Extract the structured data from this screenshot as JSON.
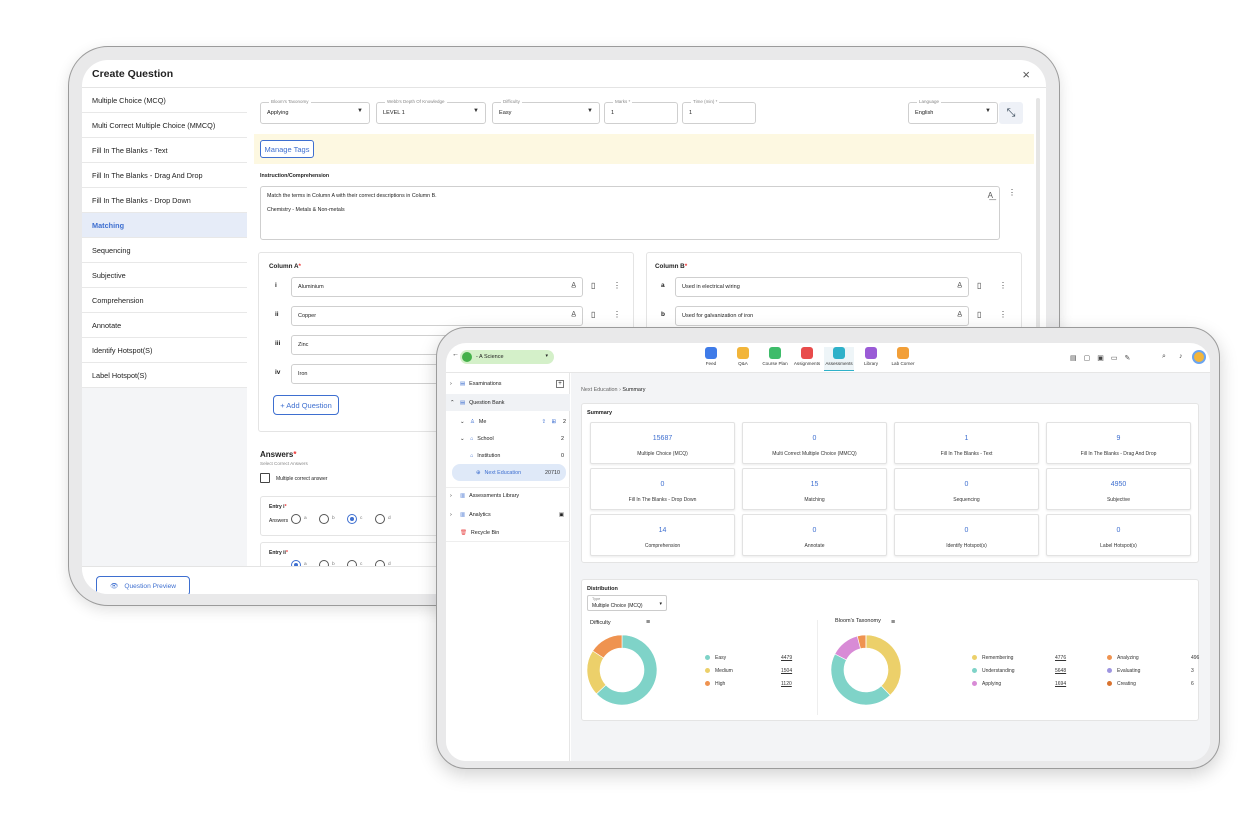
{
  "editor": {
    "title": "Create Question",
    "close_label": "×",
    "question_types": [
      {
        "label": "Multiple Choice (MCQ)",
        "active": false
      },
      {
        "label": "Multi Correct Multiple Choice (MMCQ)",
        "active": false
      },
      {
        "label": "Fill In The Blanks - Text",
        "active": false
      },
      {
        "label": "Fill In The Blanks - Drag And Drop",
        "active": false
      },
      {
        "label": "Fill In The Blanks - Drop Down",
        "active": false
      },
      {
        "label": "Matching",
        "active": true
      },
      {
        "label": "Sequencing",
        "active": false
      },
      {
        "label": "Subjective",
        "active": false
      },
      {
        "label": "Comprehension",
        "active": false
      },
      {
        "label": "Annotate",
        "active": false
      },
      {
        "label": "Identify Hotspot(S)",
        "active": false
      },
      {
        "label": "Label Hotspot(S)",
        "active": false
      }
    ],
    "fields": {
      "taxonomy": {
        "label": "Bloom's Taxonomy",
        "value": "Applying"
      },
      "knowledge": {
        "label": "Webb's Depth Of Knowledge",
        "value": "LEVEL 1"
      },
      "difficulty": {
        "label": "Difficulty",
        "value": "Easy"
      },
      "marks": {
        "label": "Marks *",
        "value": "1"
      },
      "time": {
        "label": "Time (min) *",
        "value": "1"
      },
      "language": {
        "label": "Language",
        "value": "English"
      }
    },
    "manage_tags": "Manage Tags",
    "instruction_label": "Instruction/Comprehension",
    "instruction_line1": "Match the terms in Column A with their correct descriptions in Column B.",
    "instruction_line2": "Chemistry - Metals & Non-metals",
    "column_a": {
      "title": "Column A",
      "rows": [
        {
          "key": "i",
          "value": "Aluminium"
        },
        {
          "key": "ii",
          "value": "Copper"
        },
        {
          "key": "iii",
          "value": "Zinc"
        },
        {
          "key": "iv",
          "value": "Iron"
        }
      ]
    },
    "column_b": {
      "title": "Column B",
      "rows": [
        {
          "key": "a",
          "value": "Used in electrical wiring"
        },
        {
          "key": "b",
          "value": "Used for galvanization of iron"
        }
      ]
    },
    "add_question": "+ Add Question",
    "answers_title": "Answers",
    "answers_sub": "Select Correct Answers",
    "multiple_correct": "Multiple correct answer",
    "entry1": "Entry i",
    "entry2": "Entry ii",
    "answers_label": "Answers",
    "options": [
      "a",
      "b",
      "c",
      "d"
    ],
    "preview": "Question Preview"
  },
  "dashboard": {
    "class_selector": "- A Science",
    "nav": [
      {
        "label": "Feed",
        "color": "#3f7be8"
      },
      {
        "label": "Q&A",
        "color": "#f2b53a"
      },
      {
        "label": "Course Plan",
        "color": "#3ebc6a"
      },
      {
        "label": "Assignments",
        "color": "#e84b4b"
      },
      {
        "label": "Assessments",
        "color": "#2fb1c9"
      },
      {
        "label": "Library",
        "color": "#9a5bd6"
      },
      {
        "label": "Lab Corner",
        "color": "#f29f38"
      }
    ],
    "tree": {
      "examinations": "Examinations",
      "question_bank": "Question Bank",
      "me": "Me",
      "me_count": "2",
      "school": "School",
      "school_count": "2",
      "institution": "Institution",
      "institution_count": "0",
      "next_education": "Next Education",
      "next_count": "20710",
      "assessments_library": "Assessments Library",
      "analytics": "Analytics",
      "recycle_bin": "Recycle Bin"
    },
    "breadcrumb_root": "Next Education",
    "breadcrumb_sep": "›",
    "breadcrumb_current": "Summary",
    "summary_title": "Summary",
    "summary_cards": [
      {
        "value": "15687",
        "label": "Multiple Choice (MCQ)"
      },
      {
        "value": "0",
        "label": "Multi Correct Multiple Choice (MMCQ)"
      },
      {
        "value": "1",
        "label": "Fill In The Blanks - Text"
      },
      {
        "value": "9",
        "label": "Fill In The Blanks - Drag And Drop"
      },
      {
        "value": "0",
        "label": "Fill In The Blanks - Drop Down"
      },
      {
        "value": "15",
        "label": "Matching"
      },
      {
        "value": "0",
        "label": "Sequencing"
      },
      {
        "value": "4950",
        "label": "Subjective"
      },
      {
        "value": "14",
        "label": "Comprehension"
      },
      {
        "value": "0",
        "label": "Annotate"
      },
      {
        "value": "0",
        "label": "Identify Hotspot(s)"
      },
      {
        "value": "0",
        "label": "Label Hotspot(s)"
      }
    ],
    "distribution_title": "Distribution",
    "type_label": "Type",
    "type_value": "Multiple Choice (MCQ)",
    "difficulty_title": "Difficulty",
    "bloom_title": "Bloom's Taxonomy"
  },
  "chart_data": [
    {
      "type": "pie",
      "title": "Difficulty",
      "categories": [
        "Easy",
        "Medium",
        "High"
      ],
      "values": [
        4479,
        1504,
        1120
      ],
      "colors": [
        "#7fd3c8",
        "#ecd06a",
        "#ef9350"
      ]
    },
    {
      "type": "pie",
      "title": "Bloom's Taxonomy",
      "categories": [
        "Remembering",
        "Understanding",
        "Applying",
        "Analyzing",
        "Evaluating",
        "Creating"
      ],
      "values": [
        4776,
        5648,
        1694,
        496,
        3,
        6
      ],
      "colors": [
        "#ecd06a",
        "#7fd3c8",
        "#d88bd6",
        "#ef9350",
        "#9e95e0",
        "#d9732f"
      ]
    }
  ]
}
